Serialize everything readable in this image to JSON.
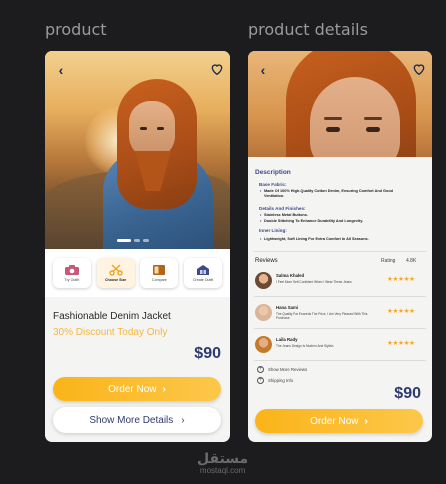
{
  "labels": {
    "left": "product",
    "right": "product details"
  },
  "product_screen": {
    "image_dots": {
      "count": 3,
      "active": 0
    },
    "options": [
      {
        "label": "Try Outfit",
        "icon": "camera-icon",
        "color": "#c9577a",
        "selected": false
      },
      {
        "label": "Choose Size",
        "icon": "scissors-icon",
        "color": "#f5a21a",
        "selected": true
      },
      {
        "label": "Compare",
        "icon": "compare-icon",
        "color": "#b5621d",
        "selected": false
      },
      {
        "label": "Create Outfit",
        "icon": "wardrobe-icon",
        "color": "#3d4a8a",
        "selected": false
      }
    ],
    "name": "Fashionable Denim Jacket",
    "discount": "30% Discount Today Only",
    "price": "$90",
    "order_label": "Order Now",
    "more_label": "Show More Details"
  },
  "details_screen": {
    "description_title": "Description",
    "sections": [
      {
        "heading": "Base Fabric:",
        "bullets": [
          "Made Of 100% High-Quality Cotton Denim, Ensuring Comfort And Good Ventilation."
        ]
      },
      {
        "heading": "Details And Finishes:",
        "bullets": [
          "Stainless Metal Buttons.",
          "Double Stitching To Enhance Durability And Longevity."
        ]
      },
      {
        "heading": "Inner Lining:",
        "bullets": [
          "Lightweight, Soft Lining For Extra Comfort In All Seasons."
        ]
      }
    ],
    "reviews_title": "Reviews",
    "rating_label": "Rating",
    "rating_value": "4.8K",
    "reviews": [
      {
        "name": "Salma Khaled",
        "text": "I Feel More Self-Confident When I Wear These Jeans",
        "stars": "★★★★★"
      },
      {
        "name": "Hana Sami",
        "text": "The Quality Far Exceeds The Price, I Am Very Pleased With This Purchase",
        "stars": "★★★★★"
      },
      {
        "name": "Laila Rady",
        "text": "The Jeans Design Is Modern And Stylish",
        "stars": "★★★★★"
      }
    ],
    "links": [
      "Show More Reviews",
      "Shipping Info"
    ],
    "price": "$90",
    "order_label": "Order Now"
  },
  "watermark": {
    "arabic": "مستقل",
    "latin": "mostaql.com"
  },
  "colors": {
    "accent": "#fbb419",
    "navy": "#2e3b6f",
    "discount": "#f5b640",
    "star": "#f2a81a"
  }
}
